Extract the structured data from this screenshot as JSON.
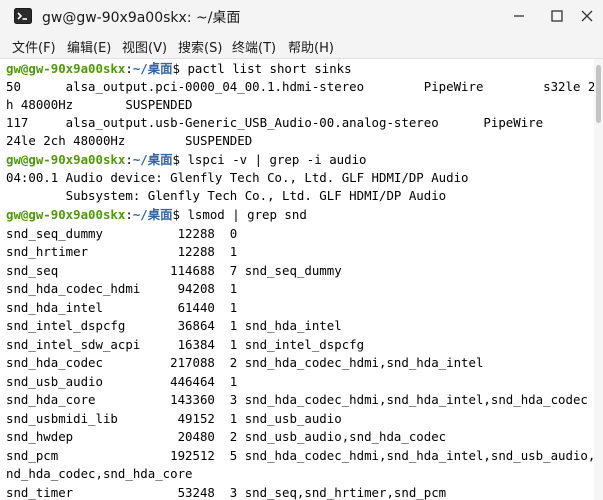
{
  "window": {
    "title": "gw@gw-90x9a00skx: ~/桌面",
    "icon": "terminal-icon",
    "controls": [
      "minimize-icon",
      "maximize-icon",
      "close-icon"
    ]
  },
  "menu": [
    {
      "label": "文件(F)"
    },
    {
      "label": "编辑(E)"
    },
    {
      "label": "视图(V)"
    },
    {
      "label": "搜索(S)"
    },
    {
      "label": "终端(T)"
    },
    {
      "label": "帮助(H)"
    }
  ],
  "prompt": {
    "user_host": "gw@gw-90x9a00skx",
    "sep": ":",
    "path": "~/桌面",
    "symbol": "$ "
  },
  "commands": [
    "pactl list short sinks",
    "lspci -v | grep -i audio",
    "lsmod | grep snd"
  ],
  "output": {
    "sinks": [
      "50      alsa_output.pci-0000_04_00.1.hdmi-stereo        PipeWire        s32le 2c",
      "h 48000Hz       SUSPENDED",
      "117     alsa_output.usb-Generic_USB_Audio-00.analog-stereo      PipeWire        s",
      "24le 2ch 48000Hz        SUSPENDED"
    ],
    "lspci": [
      "04:00.1 Audio device: Glenfly Tech Co., Ltd. GLF HDMI/DP Audio",
      "        Subsystem: Glenfly Tech Co., Ltd. GLF HDMI/DP Audio"
    ],
    "lsmod": [
      "snd_seq_dummy          12288  0",
      "snd_hrtimer            12288  1",
      "snd_seq               114688  7 snd_seq_dummy",
      "snd_hda_codec_hdmi     94208  1",
      "snd_hda_intel          61440  1",
      "snd_intel_dspcfg       36864  1 snd_hda_intel",
      "snd_intel_sdw_acpi     16384  1 snd_intel_dspcfg",
      "snd_hda_codec         217088  2 snd_hda_codec_hdmi,snd_hda_intel",
      "snd_usb_audio         446464  1",
      "snd_hda_core          143360  3 snd_hda_codec_hdmi,snd_hda_intel,snd_hda_codec",
      "snd_usbmidi_lib        49152  1 snd_usb_audio",
      "snd_hwdep              20480  2 snd_usb_audio,snd_hda_codec",
      "snd_pcm               192512  5 snd_hda_codec_hdmi,snd_hda_intel,snd_usb_audio,s",
      "nd_hda_codec,snd_hda_core",
      "snd_timer              53248  3 snd_seq,snd_hrtimer,snd_pcm"
    ]
  },
  "colors": {
    "prompt_user": "#4e9a06",
    "prompt_path": "#3465a4",
    "text": "#000000",
    "background": "#ffffff",
    "chrome": "#f4f4f4"
  }
}
